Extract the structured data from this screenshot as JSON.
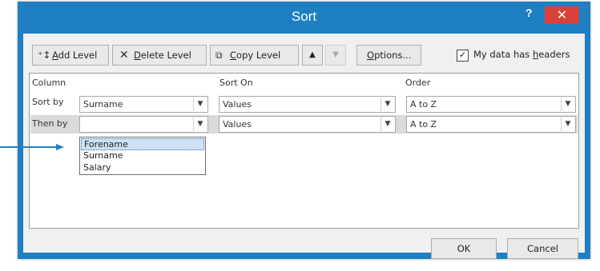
{
  "dialog": {
    "title": "Sort",
    "help": "?",
    "close": "✕"
  },
  "toolbar": {
    "add_level": {
      "pre": "",
      "ul": "A",
      "post": "dd Level"
    },
    "delete_level": {
      "pre": "",
      "ul": "D",
      "post": "elete Level"
    },
    "copy_level": {
      "pre": "",
      "ul": "C",
      "post": "opy Level"
    },
    "move_up": "▲",
    "move_down": "▼",
    "options": {
      "pre": "",
      "ul": "O",
      "post": "ptions..."
    },
    "headers_checkbox": {
      "checked": "✓",
      "pre": "My data has ",
      "ul": "h",
      "post": "eaders"
    }
  },
  "grid": {
    "headers": {
      "column": "Column",
      "sort_on": "Sort On",
      "order": "Order"
    },
    "rows": [
      {
        "label": "Sort by",
        "column": "Surname",
        "sort_on": "Values",
        "order": "A to Z"
      },
      {
        "label": "Then by",
        "column": "",
        "sort_on": "Values",
        "order": "A to Z"
      }
    ]
  },
  "dropdown": {
    "options": [
      "Forename",
      "Surname",
      "Salary"
    ],
    "selected": "Forename"
  },
  "footer": {
    "ok": "OK",
    "cancel": "Cancel"
  },
  "colors": {
    "titlebar": "#1e7fc3",
    "close": "#d9423a",
    "arrow": "#1e7fc3"
  }
}
